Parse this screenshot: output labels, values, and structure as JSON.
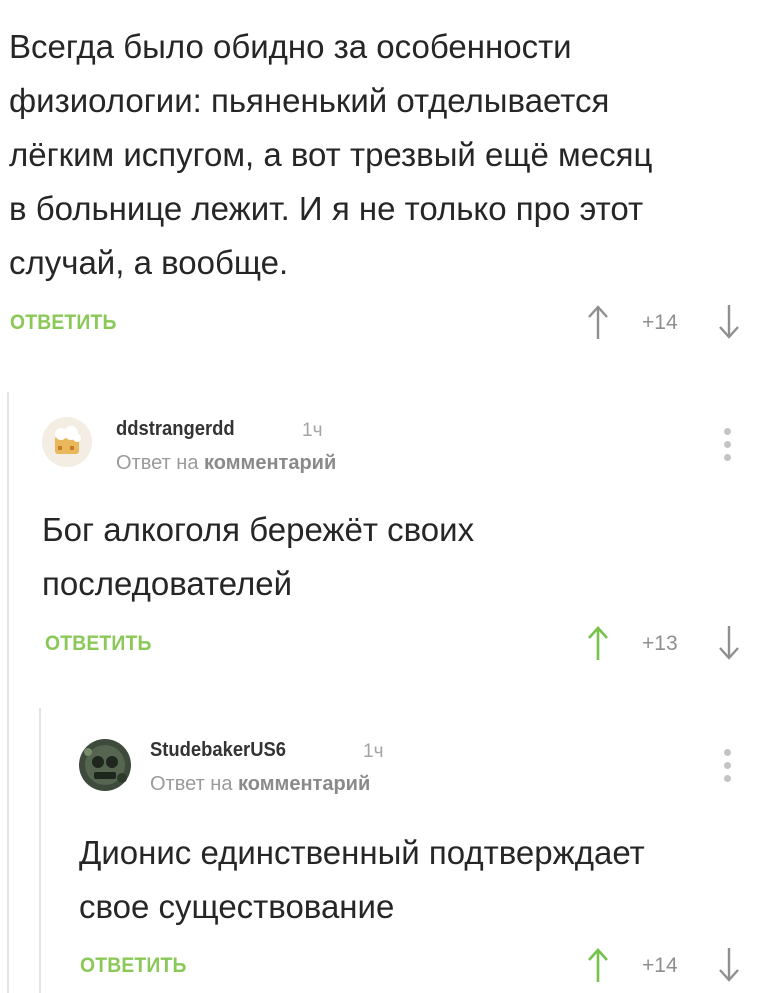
{
  "comments": [
    {
      "text_lines": [
        "Всегда было обидно за особенности",
        "физиологии: пьяненький отделывается",
        "лёгким испугом, а вот трезвый ещё месяц",
        "в больнице лежит. И я не только про этот",
        "случай, а вообще."
      ],
      "reply_label": "ОТВЕТИТЬ",
      "rating": "+14"
    },
    {
      "username": "ddstrangerdd",
      "time": "1ч",
      "reply_prefix": "Ответ на",
      "reply_target": "комментарий",
      "text_lines": [
        "Бог алкоголя бережёт своих",
        "последователей"
      ],
      "reply_label": "ОТВЕТИТЬ",
      "rating": "+13"
    },
    {
      "username": "StudebakerUS6",
      "time": "1ч",
      "reply_prefix": "Ответ на",
      "reply_target": "комментарий",
      "text_lines": [
        "Дионис единственный подтверждает",
        "свое существование"
      ],
      "reply_label": "ОТВЕТИТЬ",
      "rating": "+14"
    }
  ],
  "colors": {
    "accent": "#8ac858",
    "upvote_active": "#76c24a",
    "muted": "#9a9a9a",
    "thread_line": "#e4e4e4"
  },
  "icons": [
    "arrow-up-icon",
    "arrow-down-icon",
    "more-vertical-icon",
    "avatar"
  ]
}
